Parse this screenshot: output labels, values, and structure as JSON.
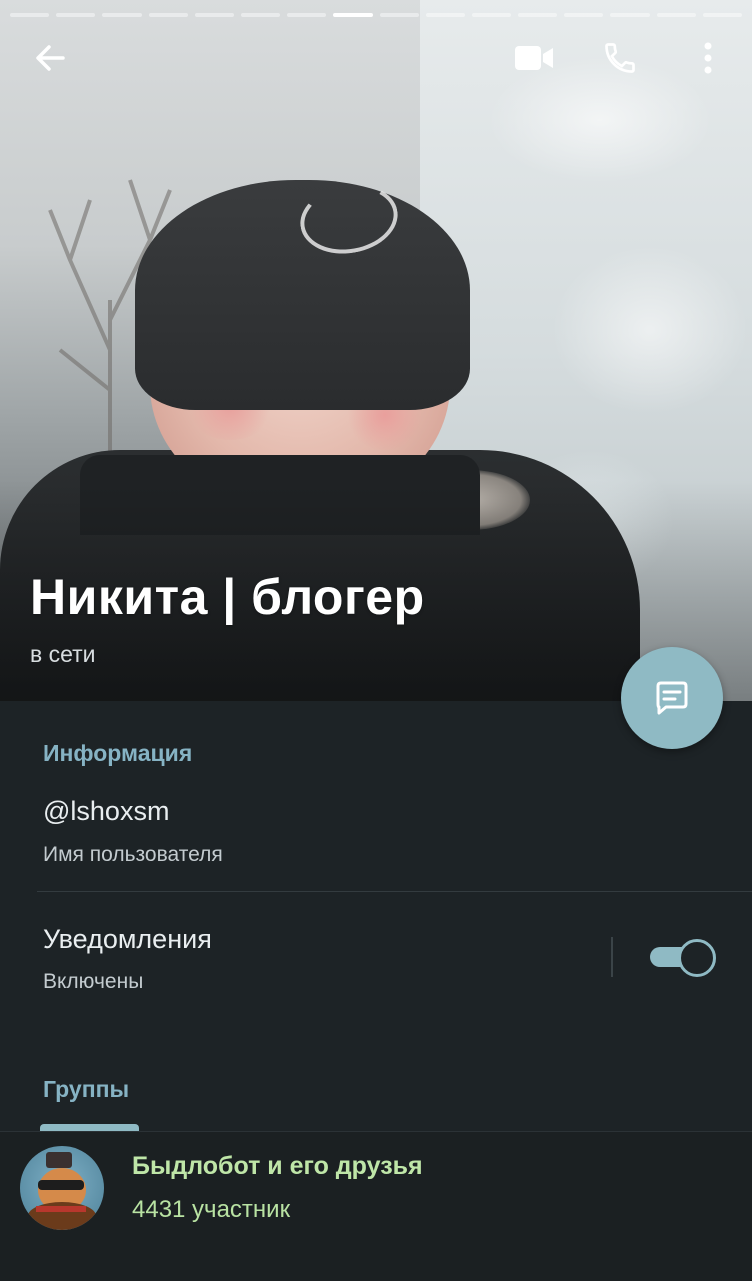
{
  "profile": {
    "name": "Никита | блогер",
    "status": "в сети"
  },
  "story_progress": {
    "total": 16,
    "active_index": 7
  },
  "toolbar": {
    "back_icon": "arrow-left-icon",
    "video_icon": "video-camera-icon",
    "call_icon": "phone-icon",
    "more_icon": "more-vertical-icon"
  },
  "info": {
    "section_title": "Информация",
    "username": "@lshoxsm",
    "username_caption": "Имя пользователя",
    "notifications_label": "Уведомления",
    "notifications_value": "Включены",
    "notifications_enabled": true
  },
  "groups": {
    "section_title": "Группы",
    "items": [
      {
        "name": "Быдлобот и его друзья",
        "members": "4431 участник"
      }
    ]
  },
  "colors": {
    "accent": "#8fbac4",
    "background": "#1d2326",
    "section_title": "#86b3c4",
    "group_text": "#bfe6a8"
  }
}
